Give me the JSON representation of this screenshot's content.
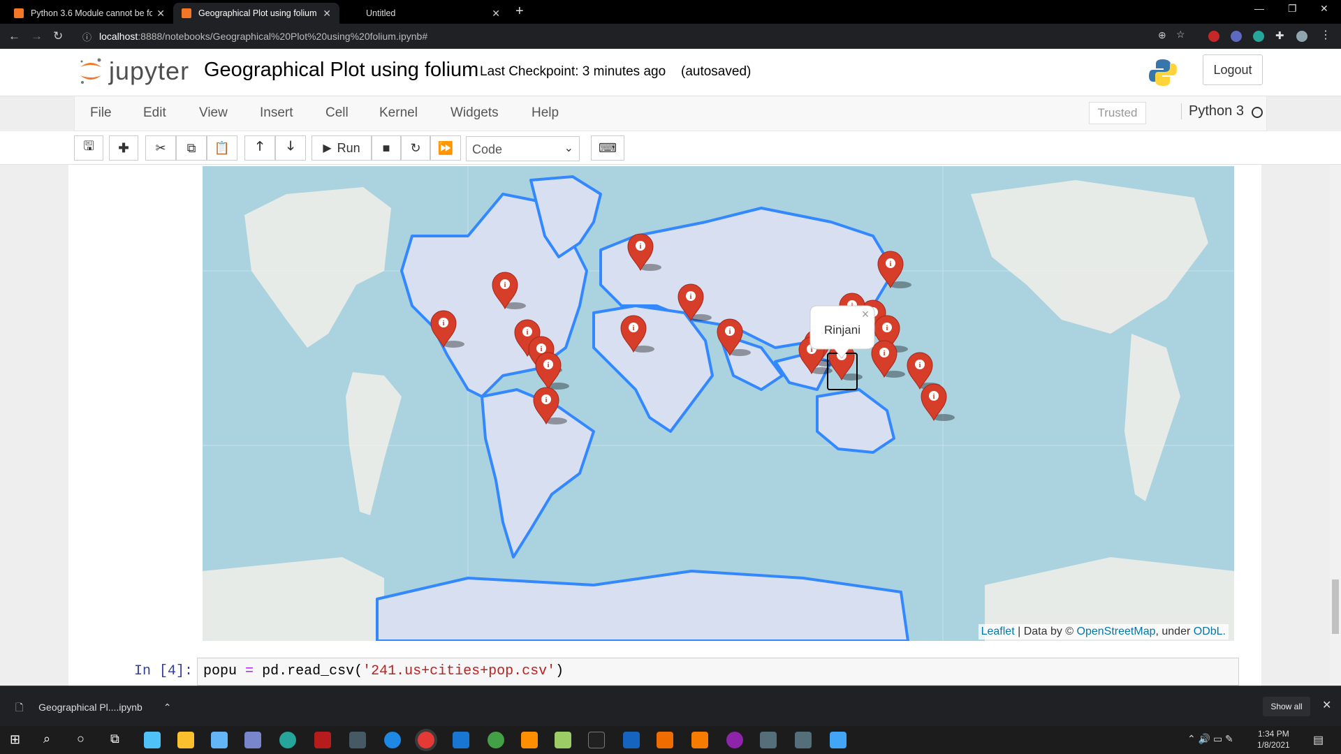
{
  "browser": {
    "tabs": [
      {
        "title": "Python 3.6 Module cannot be fo",
        "active": false
      },
      {
        "title": "Geographical Plot using folium -",
        "active": true
      },
      {
        "title": "Untitled",
        "active": false
      }
    ],
    "url_host": "localhost",
    "url_rest": ":8888/notebooks/Geographical%20Plot%20using%20folium.ipynb#"
  },
  "jupyter": {
    "logo_text": "jupyter",
    "notebook_title": "Geographical Plot using folium",
    "checkpoint": "Last Checkpoint: 3 minutes ago",
    "autosaved": "(autosaved)",
    "logout_label": "Logout",
    "menu": [
      "File",
      "Edit",
      "View",
      "Insert",
      "Cell",
      "Kernel",
      "Widgets",
      "Help"
    ],
    "trusted_label": "Trusted",
    "kernel_name": "Python 3",
    "toolbar": {
      "run_label": "Run",
      "cell_type": "Code"
    }
  },
  "map": {
    "popup_text": "Rinjani",
    "popup_close": "×",
    "marker_glyph": "i",
    "attribution": {
      "leaflet": "Leaflet",
      "data_by": "| Data by ©",
      "osm": "OpenStreetMap",
      "under": ", under",
      "license": "ODbL."
    }
  },
  "cell": {
    "prompt": "In [4]:",
    "code_var": "popu",
    "code_op": "=",
    "code_call": "pd.read_csv(",
    "code_str": "'241.us+cities+pop.csv'",
    "code_end": ")"
  },
  "downloads": {
    "file_name": "Geographical Pl....ipynb",
    "show_all": "Show all"
  },
  "taskbar": {
    "time": "1:34 PM",
    "date": "1/8/2021"
  },
  "colors": {
    "accent_orange": "#f37726",
    "marker_red": "#d63e2a",
    "border_blue": "#3388ff",
    "ocean": "#aad3df"
  }
}
